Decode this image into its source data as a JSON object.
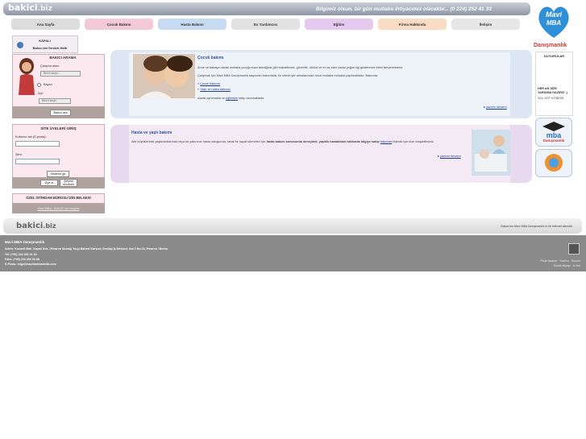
{
  "brand": {
    "logo": "bakici",
    "logo_tld": ".biz",
    "tagline": "Bilgimiz olsun, bir gün mutlaka ihtiyacımız olacaktır... (0 224) 252 41 33"
  },
  "nav": [
    "Ana Sayfa",
    "Çocuk Bakımı",
    "Hasta Bakımı",
    "Ev Yardımcısı",
    "Eğitim",
    "Firma Hakkında",
    "İletişim"
  ],
  "right": {
    "mavi": "Mavi",
    "mba": "MBA",
    "danismanlik": "Danışmanlık",
    "duyurular": "DUYURULAR",
    "ann_title": "HER AN SİZE YARDIMA HAZIRIZ :)",
    "ann_body": "SOL ÜST KÖŞEDE",
    "badge1": "Danışmanlık"
  },
  "sidebar": {
    "support_title": "KAPALI",
    "support_sub": "Bakıcı.biz Destek Hattı",
    "search_title": "BAKICI ARAMA",
    "nitelik_label": "Çalışma alanı:",
    "nitelik_value": "Birini seçin...",
    "cinsiyet": "Bayan",
    "il_label": "İlçe:",
    "il_value": "Birini seçin",
    "search_btn": "Bakıcı ara",
    "login_title": "SİTE ÜYELERİ GİRİŞ",
    "user_label": "Kullanıcı adı (E-posta):",
    "pass_label": "Şifre:",
    "login_btn": "Sisteme gir",
    "signup_btn": "Üye ol",
    "forgot_btn": "Şifremi unuttum",
    "izin_title": "ÖZEL İSTİHDAM BÜROSU İZİN BELGESİ",
    "izin_link": "Mavi MBA - İŞKUR izin belgesi"
  },
  "card1": {
    "title": "Çocuk bakımı",
    "p1": "Anne ve babaya olarak mutlaka çocuğunuza istediğiniz gibi bakabilecek, güvenilir, dürüst ve en az sizin kadar yoğun ilgi gösterecek birini isteyeceksiniz.",
    "p2": "Çalışmak için Mavi MBA Danışmanlık başvuran bakıcılarla, bu sitede yer almalarından önce mutlaka mülakat yapılmaktadır. Bakıcılar;",
    "l1": "Çocuk bakıcısı",
    "l2": "Yaşlı ve hasta bakıcısı",
    "p3": "olarak ayrılmakta ve",
    "p3_link": "eğitimleri",
    "p3_end": "takip olunmaktadır.",
    "more": "yazının devamı"
  },
  "card2": {
    "title": "Hasta ve yaşlı bakımı",
    "p1a": "Aile büyüklerinizi yaşlandıklarında veya bir yakınınız hasta olduğunda, rahat bir hayat sürmeleri için",
    "p1b": "hasta bakımı konusunda deneyimli, yaşlılık hastalıkları hakkında bilgiye sahip",
    "p1c": "bakıcılar",
    "p1d": "bulmak için bize ulaşabilirsiniz.",
    "more": "yazının devamı"
  },
  "footer": {
    "logo": "bakici",
    "logo_tld": ".biz",
    "right": "Bakıcı.biz Mavi MBA Danışmanlık'ın bir internet sitesidir",
    "company": "Mavi MBA Danışmanlık",
    "addr": "Adres: Kocasil Mah. Kayalı Sok. (Pınarca Ulubağ Yorgi Bahesi Karşısı) Ossilap İş Merkezi, Kat 3 No:24, Pınarca / Bursa",
    "tel": "Tel: (+90) 224 252 41 33",
    "fax": "Faks: (+90) 224 252 60 88",
    "email": "E-Posta: bilgi@mavidanismanlik.com",
    "r1": "Proje tasarım · Yazılım · Sunum",
    "r2": "Teknik altyapı · A.Veri"
  }
}
